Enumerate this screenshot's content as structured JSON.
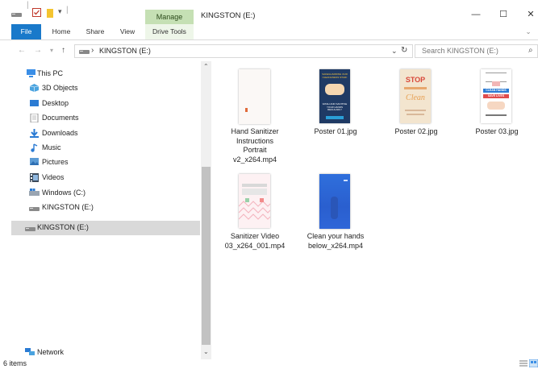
{
  "window": {
    "title": "KINGSTON (E:)",
    "manage_tab": "Manage",
    "controls": {
      "minimize": "—",
      "maximize": "☐",
      "close": "✕",
      "expand": "⌄"
    }
  },
  "ribbon": {
    "tabs": [
      "File",
      "Home",
      "Share",
      "View",
      "Drive Tools"
    ]
  },
  "address": {
    "path_segment": "KINGSTON (E:)",
    "separator": "›",
    "search_placeholder": "Search KINGSTON (E:)"
  },
  "nav": {
    "items": [
      {
        "label": "This PC",
        "icon": "this-pc-icon"
      },
      {
        "label": "3D Objects",
        "icon": "3d-objects-icon"
      },
      {
        "label": "Desktop",
        "icon": "desktop-icon"
      },
      {
        "label": "Documents",
        "icon": "documents-icon"
      },
      {
        "label": "Downloads",
        "icon": "downloads-icon"
      },
      {
        "label": "Music",
        "icon": "music-icon"
      },
      {
        "label": "Pictures",
        "icon": "pictures-icon"
      },
      {
        "label": "Videos",
        "icon": "videos-icon"
      },
      {
        "label": "Windows (C:)",
        "icon": "windows-drive-icon"
      },
      {
        "label": "KINGSTON (E:)",
        "icon": "usb-drive-icon"
      },
      {
        "label": "KINGSTON (E:)",
        "icon": "usb-drive-icon"
      },
      {
        "label": "Network",
        "icon": "network-icon"
      }
    ]
  },
  "files": [
    {
      "name": "Hand Sanitizer\nInstructions\nPortrait\nv2_x264.mp4",
      "type": "video"
    },
    {
      "name": "Poster 01.jpg",
      "type": "image",
      "thumb_text": [
        "SAFEGUARDING OUR CLEANLINESS STAFF",
        "WASH AND SANITISE YOUR HANDS REGULARLY"
      ]
    },
    {
      "name": "Poster 02.jpg",
      "type": "image",
      "thumb_text": [
        "STOP",
        "Clean"
      ]
    },
    {
      "name": "Poster 03.jpg",
      "type": "image",
      "thumb_text": [
        "CLEAN HANDS",
        "SAVE LIVES"
      ]
    },
    {
      "name": "Sanitizer Video\n03_x264_001.mp4",
      "type": "video"
    },
    {
      "name": "Clean your hands\nbelow_x264.mp4",
      "type": "video"
    }
  ],
  "status": {
    "item_count": "6 items"
  },
  "colors": {
    "accent": "#1979ca",
    "manage": "#c5e0b4",
    "selection": "#d9d9d9"
  }
}
